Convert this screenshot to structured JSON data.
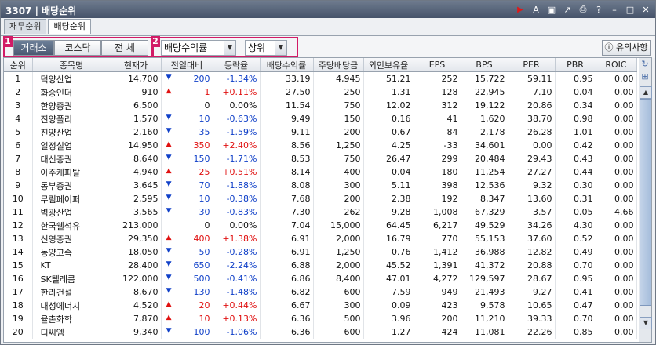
{
  "window": {
    "title": "3307 | 배당순위"
  },
  "tabs": [
    "재무순위",
    "배당순위"
  ],
  "toolbar": {
    "badge1": "1",
    "badge2": "2",
    "market_buttons": [
      "거래소",
      "코스닥",
      "전   체"
    ],
    "market_selected": "거래소",
    "sort_combo": "배당수익률",
    "order_combo": "상위",
    "help_button": "유의사항"
  },
  "table": {
    "headers": [
      "순위",
      "종목명",
      "현재가",
      "전일대비",
      "등락율",
      "배당수익률",
      "주당배당금",
      "외인보유율",
      "EPS",
      "BPS",
      "PER",
      "PBR",
      "ROIC"
    ],
    "rows": [
      {
        "rank": "1",
        "name": "덕양산업",
        "price": "14,700",
        "dir": "down",
        "change": "200",
        "rate": "-1.34%",
        "yield": "33.19",
        "dps": "4,945",
        "foreign": "51.21",
        "eps": "252",
        "bps": "15,722",
        "per": "59.11",
        "pbr": "0.95",
        "roic": "0.00"
      },
      {
        "rank": "2",
        "name": "화승인더",
        "price": "910",
        "dir": "up",
        "change": "1",
        "rate": "+0.11%",
        "yield": "27.50",
        "dps": "250",
        "foreign": "1.31",
        "eps": "128",
        "bps": "22,945",
        "per": "7.10",
        "pbr": "0.04",
        "roic": "0.00"
      },
      {
        "rank": "3",
        "name": "한양증권",
        "price": "6,500",
        "dir": "none",
        "change": "0",
        "rate": "0.00%",
        "yield": "11.54",
        "dps": "750",
        "foreign": "12.02",
        "eps": "312",
        "bps": "19,122",
        "per": "20.86",
        "pbr": "0.34",
        "roic": "0.00"
      },
      {
        "rank": "4",
        "name": "진양폴리",
        "price": "1,570",
        "dir": "down",
        "change": "10",
        "rate": "-0.63%",
        "yield": "9.49",
        "dps": "150",
        "foreign": "0.16",
        "eps": "41",
        "bps": "1,620",
        "per": "38.70",
        "pbr": "0.98",
        "roic": "0.00"
      },
      {
        "rank": "5",
        "name": "진양산업",
        "price": "2,160",
        "dir": "down",
        "change": "35",
        "rate": "-1.59%",
        "yield": "9.11",
        "dps": "200",
        "foreign": "0.67",
        "eps": "84",
        "bps": "2,178",
        "per": "26.28",
        "pbr": "1.01",
        "roic": "0.00"
      },
      {
        "rank": "6",
        "name": "일정실업",
        "price": "14,950",
        "dir": "up",
        "change": "350",
        "rate": "+2.40%",
        "yield": "8.56",
        "dps": "1,250",
        "foreign": "4.25",
        "eps": "-33",
        "bps": "34,601",
        "per": "0.00",
        "pbr": "0.42",
        "roic": "0.00"
      },
      {
        "rank": "7",
        "name": "대신증권",
        "price": "8,640",
        "dir": "down",
        "change": "150",
        "rate": "-1.71%",
        "yield": "8.53",
        "dps": "750",
        "foreign": "26.47",
        "eps": "299",
        "bps": "20,484",
        "per": "29.43",
        "pbr": "0.43",
        "roic": "0.00"
      },
      {
        "rank": "8",
        "name": "아주캐피탈",
        "price": "4,940",
        "dir": "up",
        "change": "25",
        "rate": "+0.51%",
        "yield": "8.14",
        "dps": "400",
        "foreign": "0.04",
        "eps": "180",
        "bps": "11,254",
        "per": "27.27",
        "pbr": "0.44",
        "roic": "0.00"
      },
      {
        "rank": "9",
        "name": "동부증권",
        "price": "3,645",
        "dir": "down",
        "change": "70",
        "rate": "-1.88%",
        "yield": "8.08",
        "dps": "300",
        "foreign": "5.11",
        "eps": "398",
        "bps": "12,536",
        "per": "9.32",
        "pbr": "0.30",
        "roic": "0.00"
      },
      {
        "rank": "10",
        "name": "무림페이퍼",
        "price": "2,595",
        "dir": "down",
        "change": "10",
        "rate": "-0.38%",
        "yield": "7.68",
        "dps": "200",
        "foreign": "2.38",
        "eps": "192",
        "bps": "8,347",
        "per": "13.60",
        "pbr": "0.31",
        "roic": "0.00"
      },
      {
        "rank": "11",
        "name": "벽광산업",
        "price": "3,565",
        "dir": "down",
        "change": "30",
        "rate": "-0.83%",
        "yield": "7.30",
        "dps": "262",
        "foreign": "9.28",
        "eps": "1,008",
        "bps": "67,329",
        "per": "3.57",
        "pbr": "0.05",
        "roic": "4.66"
      },
      {
        "rank": "12",
        "name": "한국쉘석유",
        "price": "213,000",
        "dir": "none",
        "change": "0",
        "rate": "0.00%",
        "yield": "7.04",
        "dps": "15,000",
        "foreign": "64.45",
        "eps": "6,217",
        "bps": "49,529",
        "per": "34.26",
        "pbr": "4.30",
        "roic": "0.00"
      },
      {
        "rank": "13",
        "name": "신영증권",
        "price": "29,350",
        "dir": "up",
        "change": "400",
        "rate": "+1.38%",
        "yield": "6.91",
        "dps": "2,000",
        "foreign": "16.79",
        "eps": "770",
        "bps": "55,153",
        "per": "37.60",
        "pbr": "0.52",
        "roic": "0.00"
      },
      {
        "rank": "14",
        "name": "동양고속",
        "price": "18,050",
        "dir": "down",
        "change": "50",
        "rate": "-0.28%",
        "yield": "6.91",
        "dps": "1,250",
        "foreign": "0.76",
        "eps": "1,412",
        "bps": "36,988",
        "per": "12.82",
        "pbr": "0.49",
        "roic": "0.00"
      },
      {
        "rank": "15",
        "name": "KT",
        "price": "28,400",
        "dir": "down",
        "change": "650",
        "rate": "-2.24%",
        "yield": "6.88",
        "dps": "2,000",
        "foreign": "45.52",
        "eps": "1,391",
        "bps": "41,372",
        "per": "20.88",
        "pbr": "0.70",
        "roic": "0.00"
      },
      {
        "rank": "16",
        "name": "SK텔레콤",
        "price": "122,000",
        "dir": "down",
        "change": "500",
        "rate": "-0.41%",
        "yield": "6.86",
        "dps": "8,400",
        "foreign": "47.01",
        "eps": "4,272",
        "bps": "129,597",
        "per": "28.67",
        "pbr": "0.95",
        "roic": "0.00"
      },
      {
        "rank": "17",
        "name": "한라건설",
        "price": "8,670",
        "dir": "down",
        "change": "130",
        "rate": "-1.48%",
        "yield": "6.82",
        "dps": "600",
        "foreign": "7.59",
        "eps": "949",
        "bps": "21,493",
        "per": "9.27",
        "pbr": "0.41",
        "roic": "0.00"
      },
      {
        "rank": "18",
        "name": "대성에너지",
        "price": "4,520",
        "dir": "up",
        "change": "20",
        "rate": "+0.44%",
        "yield": "6.67",
        "dps": "300",
        "foreign": "0.09",
        "eps": "423",
        "bps": "9,578",
        "per": "10.65",
        "pbr": "0.47",
        "roic": "0.00"
      },
      {
        "rank": "19",
        "name": "율촌화학",
        "price": "7,870",
        "dir": "up",
        "change": "10",
        "rate": "+0.13%",
        "yield": "6.36",
        "dps": "500",
        "foreign": "3.96",
        "eps": "200",
        "bps": "11,210",
        "per": "39.33",
        "pbr": "0.70",
        "roic": "0.00"
      },
      {
        "rank": "20",
        "name": "디씨엠",
        "price": "9,340",
        "dir": "down",
        "change": "100",
        "rate": "-1.06%",
        "yield": "6.36",
        "dps": "600",
        "foreign": "1.27",
        "eps": "424",
        "bps": "11,081",
        "per": "22.26",
        "pbr": "0.85",
        "roic": "0.00"
      }
    ]
  },
  "colors": {
    "up": "#e01010",
    "down": "#1040c8",
    "highlight": "#d21b66"
  }
}
